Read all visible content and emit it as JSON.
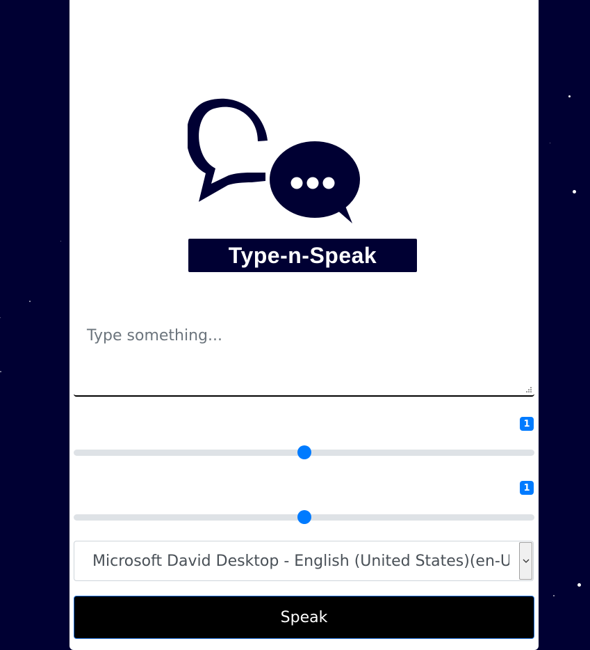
{
  "logo": {
    "text": "Type-n-Speak"
  },
  "message": {
    "placeholder": "Type something...",
    "value": ""
  },
  "rate": {
    "value": "1",
    "level": 0.5
  },
  "pitch": {
    "value": "1",
    "level": 0.5
  },
  "voice": {
    "selected": "Microsoft David Desktop - English (United States)(en-US)"
  },
  "speak": {
    "label": "Speak"
  },
  "colors": {
    "background": "#000033",
    "accent": "#007bff",
    "button": "#000000"
  }
}
